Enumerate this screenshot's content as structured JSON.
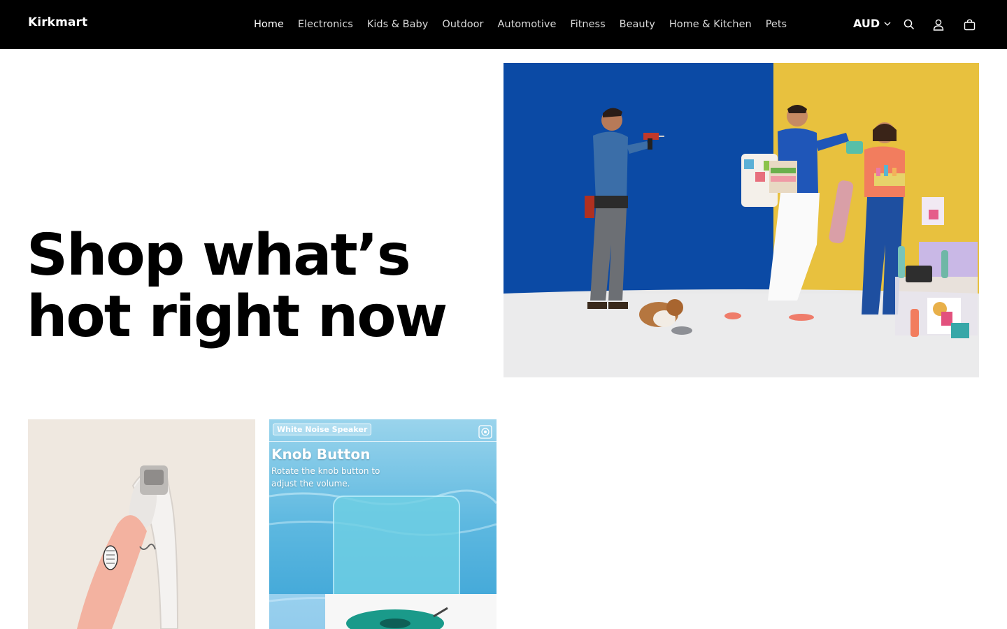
{
  "header": {
    "logo": "Kirkmart",
    "nav": [
      {
        "label": "Home",
        "active": true
      },
      {
        "label": "Electronics"
      },
      {
        "label": "Kids & Baby"
      },
      {
        "label": "Outdoor"
      },
      {
        "label": "Automotive"
      },
      {
        "label": "Fitness"
      },
      {
        "label": "Beauty"
      },
      {
        "label": "Home & Kitchen"
      },
      {
        "label": "Pets"
      }
    ],
    "currency": "AUD",
    "icons": [
      "chevron-down-icon",
      "search-icon",
      "account-icon",
      "cart-icon"
    ]
  },
  "hero": {
    "title_line1": "Shop what’s",
    "title_line2": "hot right now"
  },
  "products": {
    "speaker": {
      "badge": "White Noise Speaker",
      "heading": "Knob Button",
      "subtext": "Rotate the knob button to adjust the volume."
    }
  },
  "colors": {
    "header_bg": "#000000",
    "hero_blue": "#0b4aa5",
    "hero_yellow": "#e8c13e"
  }
}
